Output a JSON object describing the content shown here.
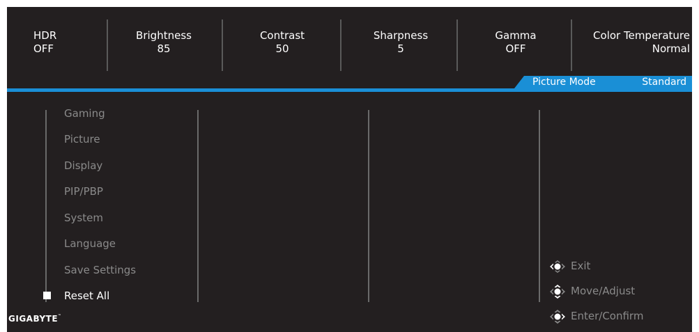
{
  "status_items": [
    {
      "label": "HDR",
      "value": "OFF"
    },
    {
      "label": "Brightness",
      "value": "85"
    },
    {
      "label": "Contrast",
      "value": "50"
    },
    {
      "label": "Sharpness",
      "value": "5"
    },
    {
      "label": "Gamma",
      "value": "OFF"
    },
    {
      "label": "Color Temperature",
      "value": "Normal"
    }
  ],
  "picture_mode": {
    "label": "Picture Mode",
    "value": "Standard"
  },
  "menu": {
    "items": [
      "Gaming",
      "Picture",
      "Display",
      "PIP/PBP",
      "System",
      "Language",
      "Save Settings",
      "Reset All"
    ],
    "active": "Reset All"
  },
  "hints": [
    {
      "icon": "joystick-left-icon",
      "label": "Exit"
    },
    {
      "icon": "joystick-all-directions-icon",
      "label": "Move/Adjust"
    },
    {
      "icon": "joystick-press-icon",
      "label": "Enter/Confirm"
    }
  ],
  "brand": {
    "name": "GIGABYTE",
    "mark": "™"
  },
  "colors": {
    "accent": "#1a8fd6",
    "background": "#231f20",
    "inactive_text": "#8a8a8a",
    "active_text": "#ffffff"
  }
}
